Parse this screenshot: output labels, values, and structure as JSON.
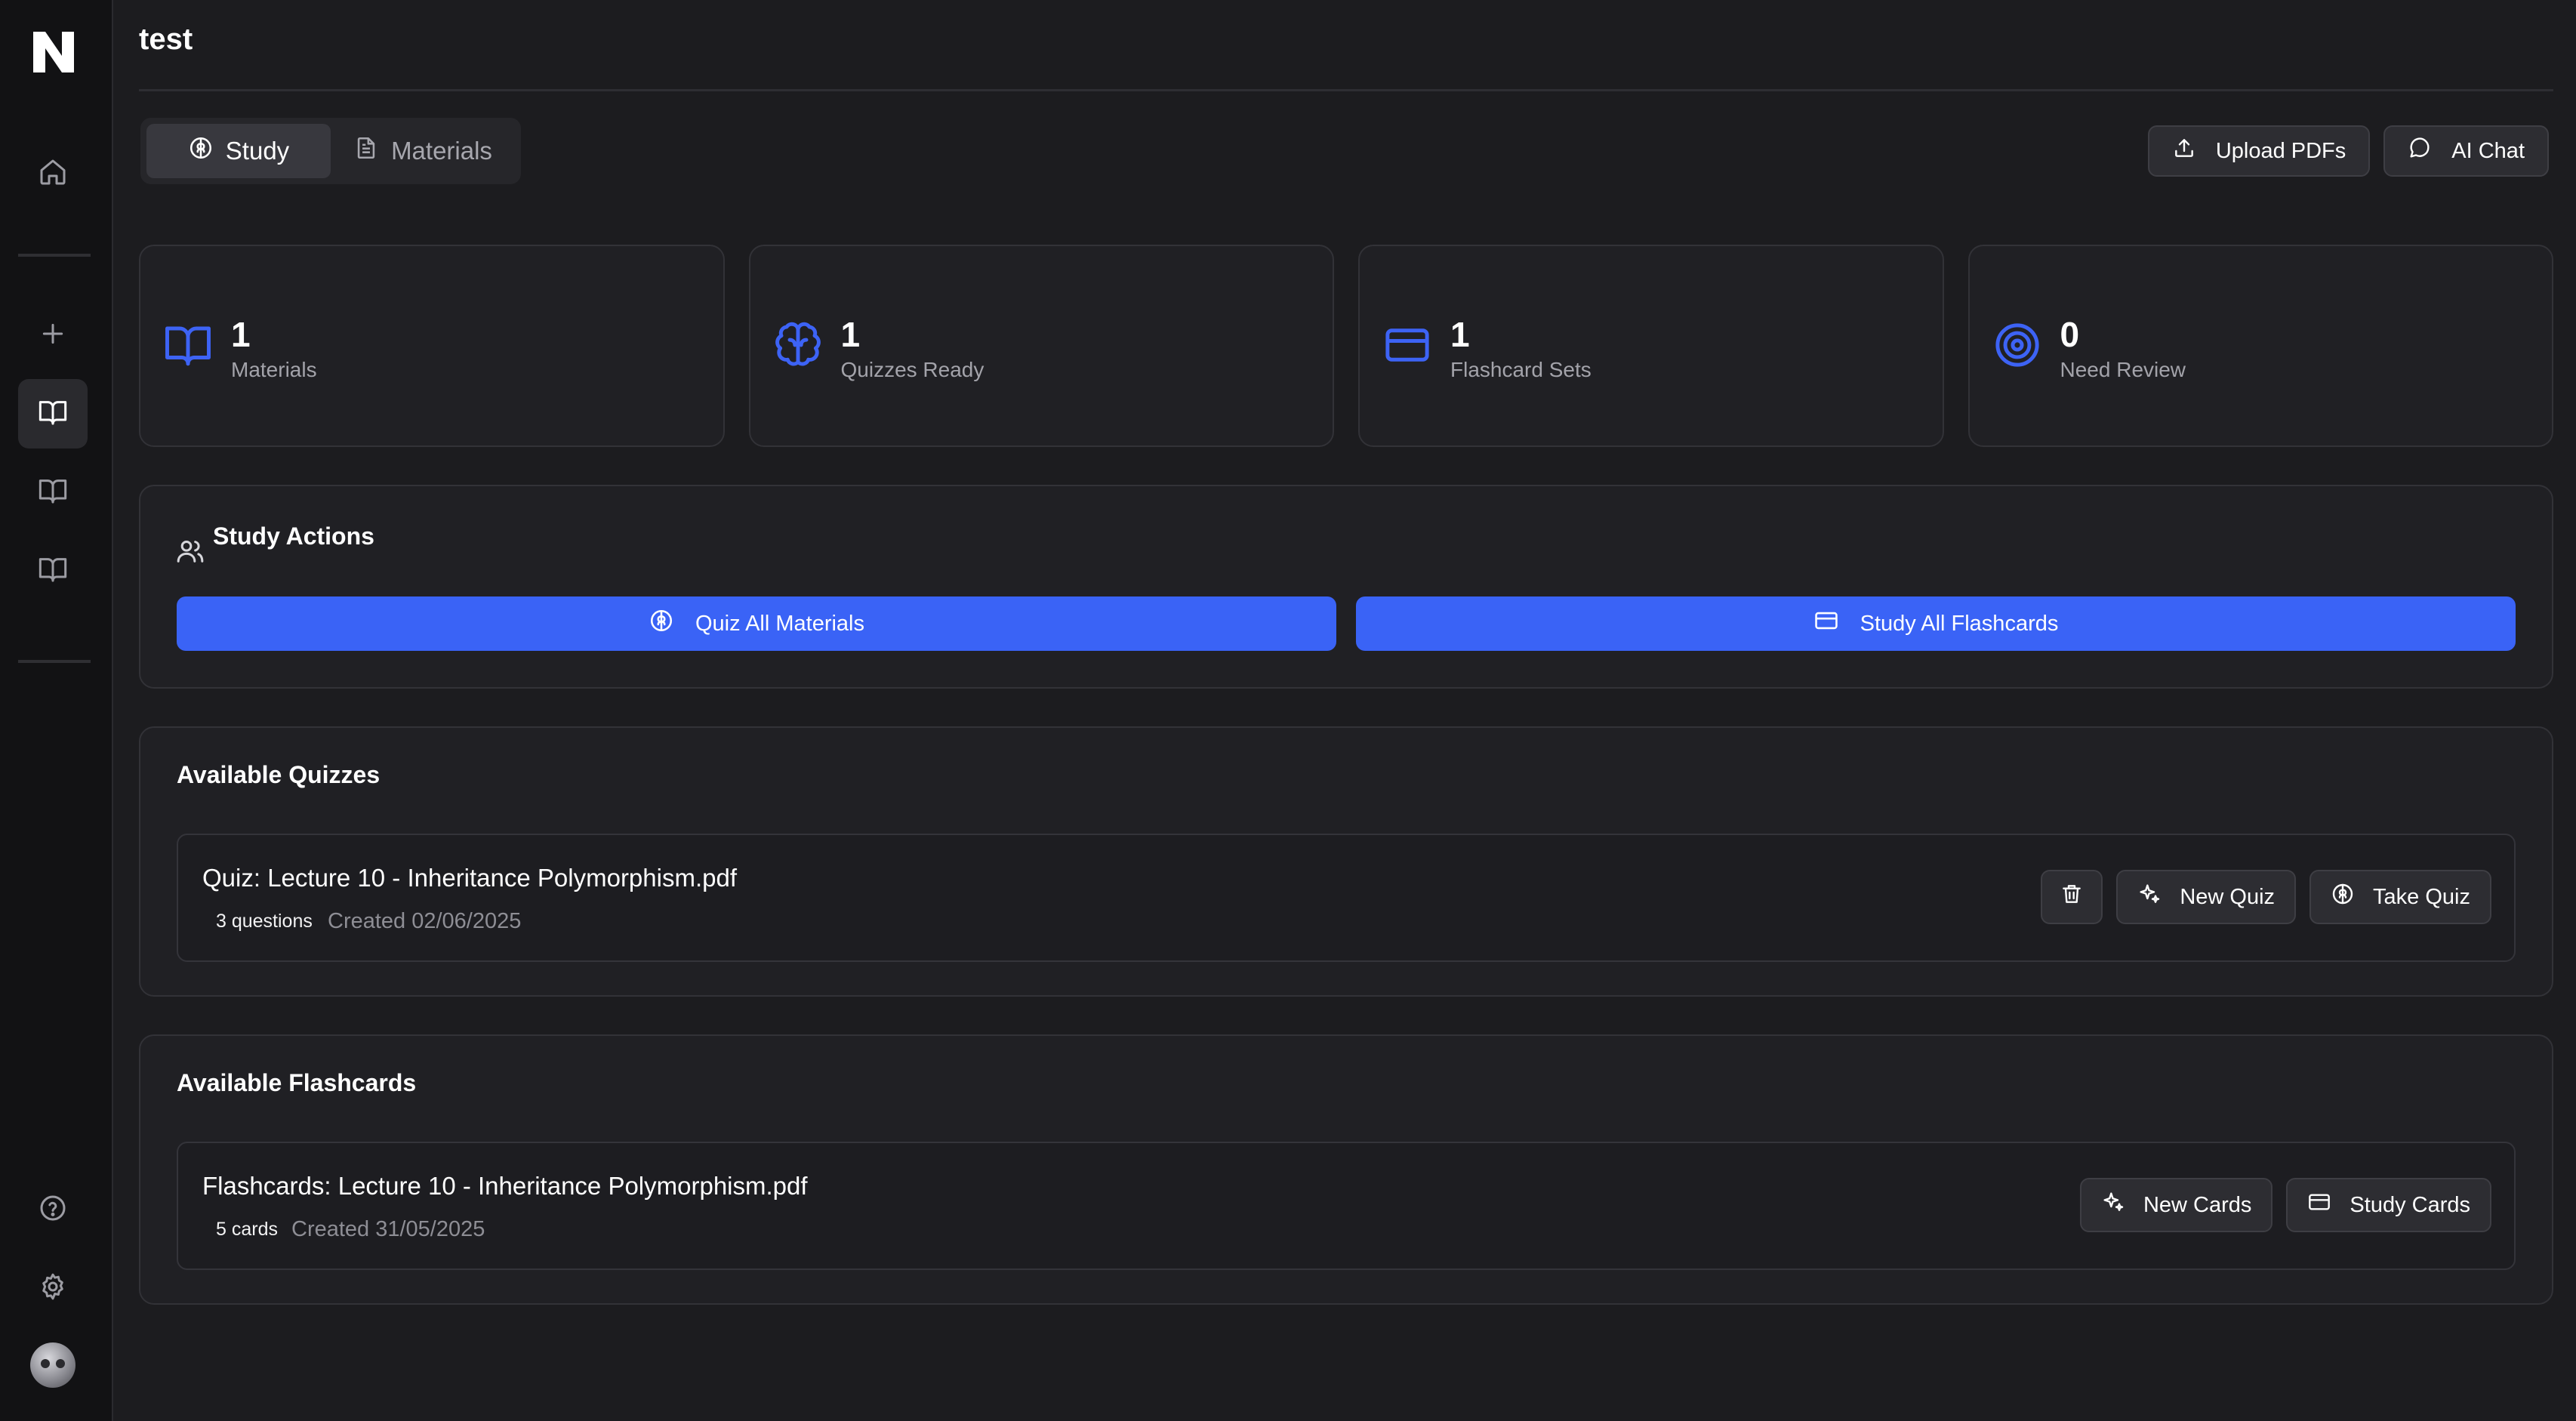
{
  "app": {
    "title": "test",
    "logo_letter": "N"
  },
  "sidebar": {
    "items": [
      {
        "icon": "home-icon"
      },
      {
        "icon": "plus-icon"
      },
      {
        "icon": "book-open-icon",
        "active": true
      },
      {
        "icon": "book-open-icon"
      },
      {
        "icon": "book-open-icon"
      }
    ],
    "bottom": [
      {
        "icon": "help-circle-icon"
      },
      {
        "icon": "gear-icon"
      },
      {
        "icon": "avatar"
      }
    ]
  },
  "tabs": [
    {
      "label": "Study",
      "icon": "brain-icon",
      "active": true
    },
    {
      "label": "Materials",
      "icon": "file-text-icon",
      "active": false
    }
  ],
  "toolbar": {
    "upload_label": "Upload PDFs",
    "chat_label": "AI Chat"
  },
  "stats": [
    {
      "value": "1",
      "label": "Materials",
      "icon": "book-open-icon"
    },
    {
      "value": "1",
      "label": "Quizzes Ready",
      "icon": "brain-icon"
    },
    {
      "value": "1",
      "label": "Flashcard Sets",
      "icon": "credit-card-icon"
    },
    {
      "value": "0",
      "label": "Need Review",
      "icon": "target-icon"
    }
  ],
  "study_actions": {
    "title": "Study Actions",
    "quiz_all_label": "Quiz All Materials",
    "flashcards_all_label": "Study All Flashcards"
  },
  "quizzes": {
    "title": "Available Quizzes",
    "items": [
      {
        "title": "Quiz: Lecture 10 - Inheritance Polymorphism.pdf",
        "count": "3 questions",
        "created": "Created 02/06/2025",
        "new_label": "New Quiz",
        "take_label": "Take Quiz"
      }
    ]
  },
  "flashcards": {
    "title": "Available Flashcards",
    "items": [
      {
        "title": "Flashcards: Lecture 10 - Inheritance Polymorphism.pdf",
        "count": "5 cards",
        "created": "Created 31/05/2025",
        "new_label": "New Cards",
        "study_label": "Study Cards"
      }
    ]
  },
  "colors": {
    "accent": "#3a63f6",
    "background": "#1c1c1f",
    "sidebar": "#121214",
    "card": "#202024"
  }
}
